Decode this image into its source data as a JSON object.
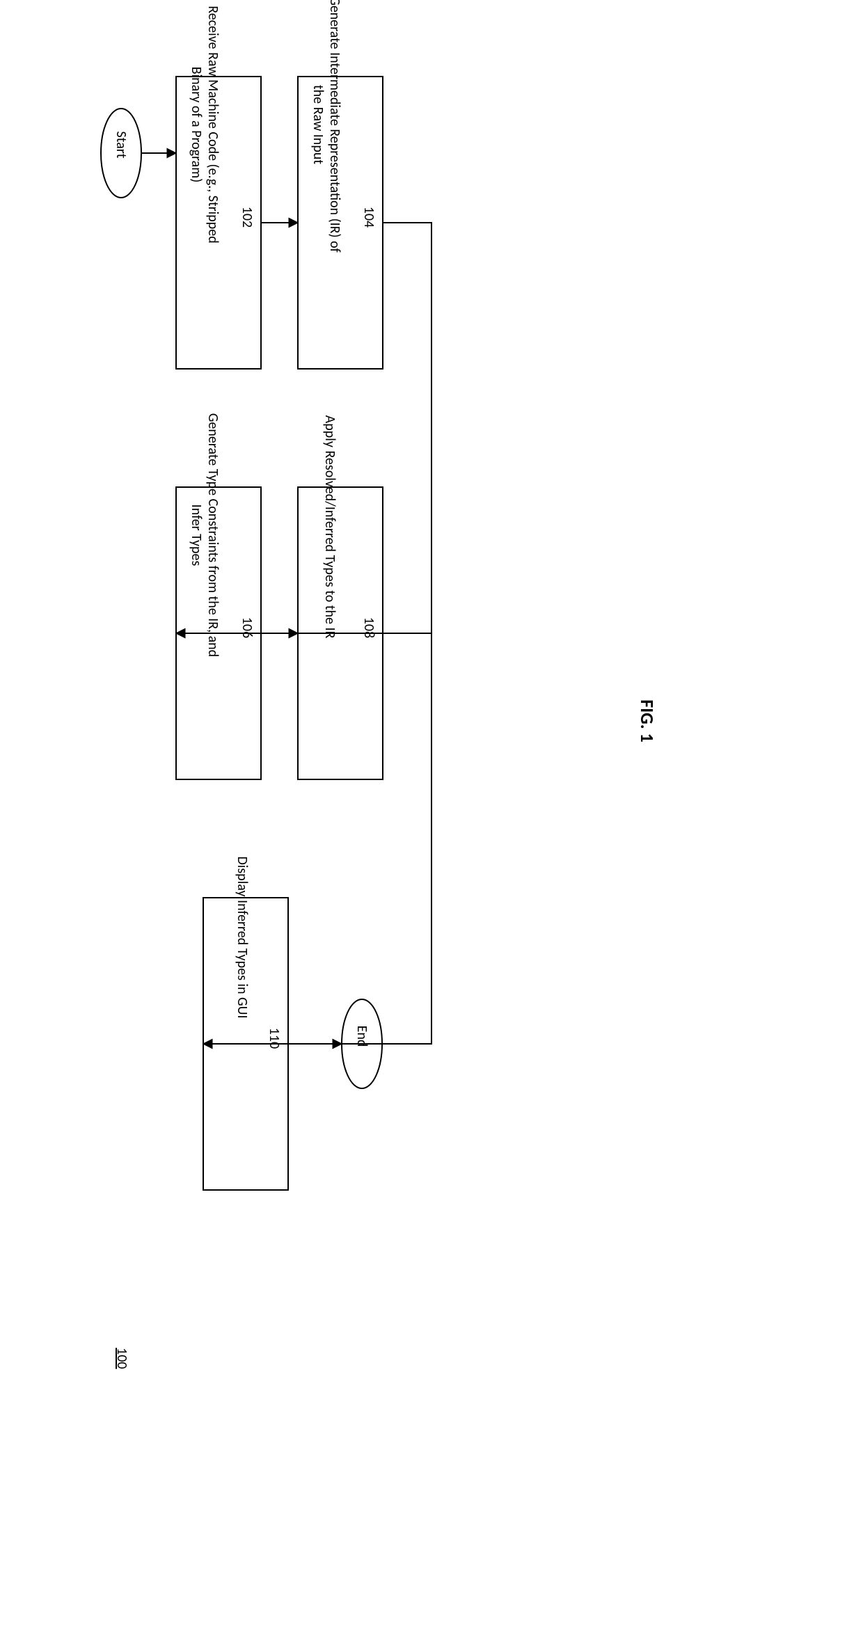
{
  "page_number": "100",
  "figure_label": "FIG. 1",
  "nodes": {
    "start": {
      "label": "Start"
    },
    "n102_main": {
      "label": "Receive Raw Machine Code (e.g., Stripped Binary of a Program)"
    },
    "n102_num": {
      "label": "102"
    },
    "n104_main": {
      "label": "Generate Intermediate Representation (IR) of the Raw Input"
    },
    "n104_num": {
      "label": "104"
    },
    "n106_main": {
      "label": "Generate Type Constraints from the IR, and Infer Types"
    },
    "n106_num": {
      "label": "106"
    },
    "n108_main": {
      "label": "Apply Resolved/Inferred Types to the IR"
    },
    "n108_num": {
      "label": "108"
    },
    "n110_main": {
      "label": "Display Inferred Types in GUI"
    },
    "n110_num": {
      "label": "110"
    },
    "end": {
      "label": "End"
    }
  }
}
